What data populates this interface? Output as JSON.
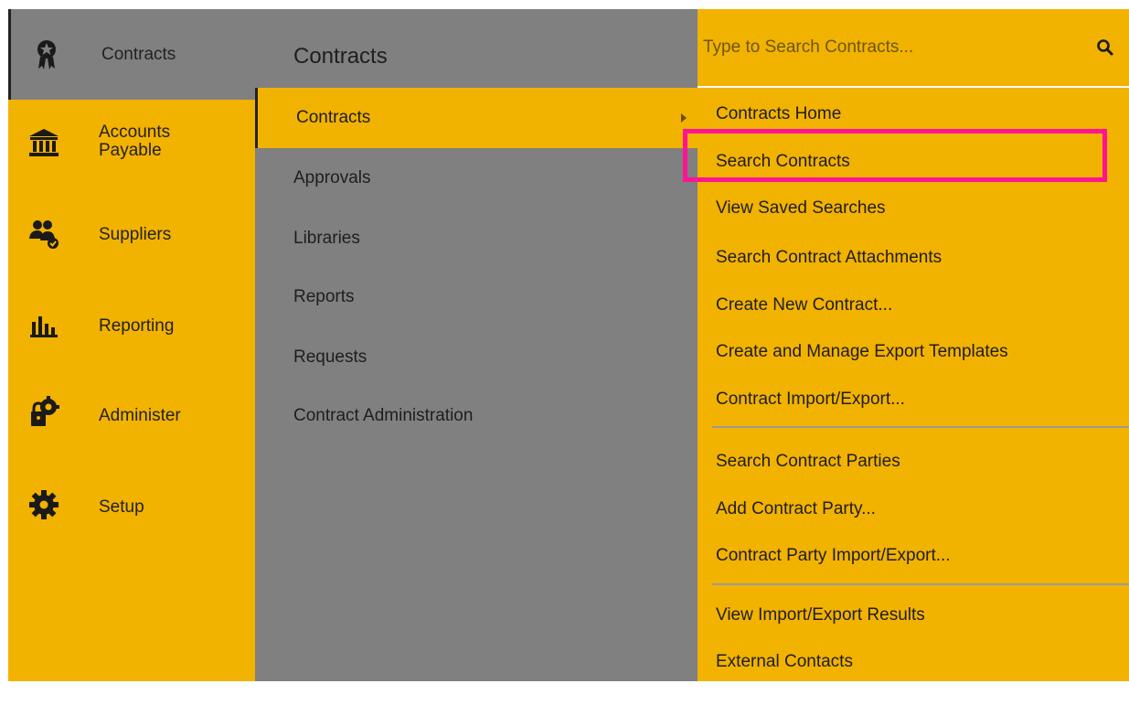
{
  "rail": {
    "items": [
      {
        "label": "Contracts",
        "icon": "award-ribbon-icon",
        "active": true
      },
      {
        "label": "Accounts Payable",
        "icon": "bank-icon"
      },
      {
        "label": "Suppliers",
        "icon": "users-icon"
      },
      {
        "label": "Reporting",
        "icon": "bar-chart-icon"
      },
      {
        "label": "Administer",
        "icon": "lock-gear-icon"
      },
      {
        "label": "Setup",
        "icon": "gear-icon"
      }
    ]
  },
  "middle": {
    "title": "Contracts",
    "items": [
      {
        "label": "Contracts",
        "active": true
      },
      {
        "label": "Approvals"
      },
      {
        "label": "Libraries"
      },
      {
        "label": "Reports"
      },
      {
        "label": "Requests"
      },
      {
        "label": "Contract Administration"
      }
    ]
  },
  "submenu": {
    "search_placeholder": "Type to Search Contracts...",
    "search_icon": "search-icon",
    "items": [
      "Contracts Home",
      "Search Contracts",
      "View Saved Searches",
      "Search Contract Attachments",
      "Create New Contract...",
      "Create and Manage Export Templates",
      "Contract Import/Export...",
      "Search Contract Parties",
      "Add Contract Party...",
      "Contract Party Import/Export...",
      "View Import/Export Results",
      "External Contacts"
    ],
    "highlighted": "Search Contracts"
  },
  "colors": {
    "accent": "#f2b200",
    "panel_gray": "#808080",
    "highlight_border": "#ff1493"
  }
}
